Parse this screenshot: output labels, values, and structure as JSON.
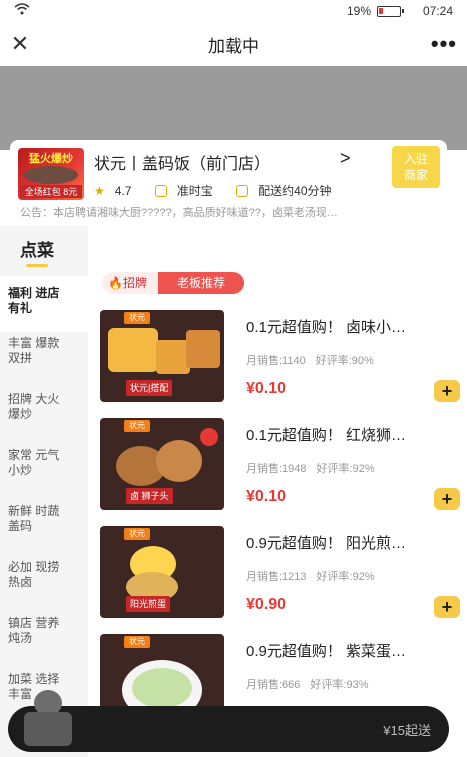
{
  "status_bar": {
    "battery": "19%",
    "time": "07:24"
  },
  "nav": {
    "title": "加载中",
    "close": "✕",
    "more": "•••"
  },
  "store": {
    "logo_top": "猛火爆炒",
    "logo_bottom": "全场红包 8元",
    "name": "状元丨盖码饭（前门店）",
    "chevron": ">",
    "follow_line1": "入驻",
    "follow_line2": "商家",
    "rating": "4.7",
    "on_time": "准时宝",
    "delivery": "配送约40分钟",
    "notice": "公告：本店聘请湘味大厨?????，高品质好味道??，卤菜老汤现…"
  },
  "sidebar": {
    "title": "点菜",
    "items": [
      {
        "label1": "福利 进店",
        "label2": "有礼"
      },
      {
        "label1": "丰富 爆款",
        "label2": "双拼"
      },
      {
        "label1": "招牌 大火",
        "label2": "爆炒"
      },
      {
        "label1": "家常 元气",
        "label2": "小炒"
      },
      {
        "label1": "新鲜 时蔬",
        "label2": "盖码"
      },
      {
        "label1": "必加 现捞",
        "label2": "热卤"
      },
      {
        "label1": "镇店 营养",
        "label2": "炖汤"
      },
      {
        "label1": "加菜 选择",
        "label2": "丰富"
      }
    ]
  },
  "tags": {
    "signature": "招牌",
    "boss": "老板推荐"
  },
  "items": [
    {
      "name": "0.1元超值购！ 卤味小…",
      "sales": "月销售:1140",
      "rate": "好评率:90%",
      "price": "¥0.10",
      "img_label": "状元|搭配",
      "brand": "状元"
    },
    {
      "name": "0.1元超值购！ 红烧狮…",
      "sales": "月销售:1948",
      "rate": "好评率:92%",
      "price": "¥0.10",
      "img_label": "卤 狮子头",
      "brand": "状元"
    },
    {
      "name": "0.9元超值购！ 阳光煎…",
      "sales": "月销售:1213",
      "rate": "好评率:92%",
      "price": "¥0.90",
      "img_label": "阳光煎蛋",
      "brand": "状元"
    },
    {
      "name": "0.9元超值购！ 紫菜蛋…",
      "sales": "月销售:666",
      "rate": "好评率:93%",
      "price": "",
      "img_label": "",
      "brand": "状元"
    }
  ],
  "cart": {
    "min_order": "¥15起送"
  },
  "colors": {
    "accent": "#f7c948",
    "price": "#e53935",
    "tag": "#ef5350",
    "banner": "#9b9b9b"
  }
}
